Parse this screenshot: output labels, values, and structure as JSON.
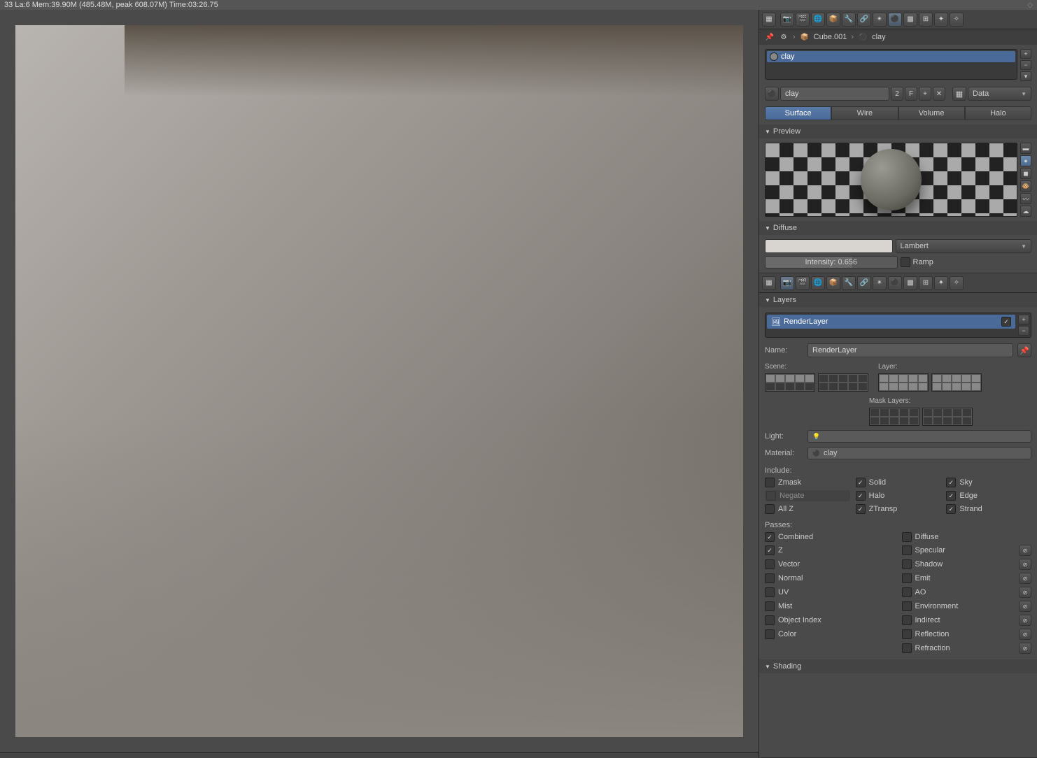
{
  "status_bar": {
    "left": "33 La:6 Mem:39.90M (485.48M, peak 608.07M) Time:03:26.75",
    "right_icon": "◇"
  },
  "properties1": {
    "tabs": [
      "▦",
      "📷",
      "🎬",
      "🌐",
      "📦",
      "🔧",
      "🔗",
      "✴",
      "⚫",
      "▩",
      "⊞",
      "✦",
      "✧"
    ],
    "breadcrumb": {
      "pin": "📌",
      "obj_icon": "📦",
      "obj_name": "Cube.001",
      "mat_icon": "⚫",
      "mat_name": "clay"
    },
    "material_slot": "clay",
    "material_name": "clay",
    "user_count": "2",
    "fake_user": "F",
    "add_new": "+",
    "unlink": "✕",
    "node_icon": "▦",
    "link_mode": "Data",
    "type_tabs": [
      "Surface",
      "Wire",
      "Volume",
      "Halo"
    ],
    "preview_label": "Preview",
    "diffuse": {
      "label": "Diffuse",
      "shader": "Lambert",
      "intensity_label": "Intensity: 0.656",
      "ramp": "Ramp"
    }
  },
  "properties2": {
    "tabs": [
      "▦",
      "📷",
      "🎬",
      "🌐",
      "📦",
      "🔧",
      "🔗",
      "✴",
      "⚫",
      "▩",
      "⊞",
      "✦",
      "✧"
    ],
    "layers_label": "Layers",
    "render_layer": "RenderLayer",
    "name_label": "Name:",
    "name_value": "RenderLayer",
    "scene_label": "Scene:",
    "layer_label": "Layer:",
    "mask_label": "Mask Layers:",
    "light_label": "Light:",
    "light_value": "",
    "material_label": "Material:",
    "material_value": "clay",
    "include_label": "Include:",
    "include": [
      {
        "label": "Zmask",
        "checked": false
      },
      {
        "label": "Solid",
        "checked": true
      },
      {
        "label": "Sky",
        "checked": true
      },
      {
        "label": "Negate",
        "checked": false,
        "disabled": true
      },
      {
        "label": "Halo",
        "checked": true
      },
      {
        "label": "Edge",
        "checked": true
      },
      {
        "label": "All Z",
        "checked": false
      },
      {
        "label": "ZTransp",
        "checked": true
      },
      {
        "label": "Strand",
        "checked": true
      }
    ],
    "passes_label": "Passes:",
    "passes_left": [
      {
        "label": "Combined",
        "checked": true,
        "excl": false
      },
      {
        "label": "Z",
        "checked": true,
        "excl": false
      },
      {
        "label": "Vector",
        "checked": false,
        "excl": false
      },
      {
        "label": "Normal",
        "checked": false,
        "excl": false
      },
      {
        "label": "UV",
        "checked": false,
        "excl": false
      },
      {
        "label": "Mist",
        "checked": false,
        "excl": false
      },
      {
        "label": "Object Index",
        "checked": false,
        "excl": false
      },
      {
        "label": "Color",
        "checked": false,
        "excl": false
      }
    ],
    "passes_right": [
      {
        "label": "Diffuse",
        "checked": false,
        "excl": false
      },
      {
        "label": "Specular",
        "checked": false,
        "excl": true
      },
      {
        "label": "Shadow",
        "checked": false,
        "excl": true
      },
      {
        "label": "Emit",
        "checked": false,
        "excl": true
      },
      {
        "label": "AO",
        "checked": false,
        "excl": true
      },
      {
        "label": "Environment",
        "checked": false,
        "excl": true
      },
      {
        "label": "Indirect",
        "checked": false,
        "excl": true
      },
      {
        "label": "Reflection",
        "checked": false,
        "excl": true
      },
      {
        "label": "Refraction",
        "checked": false,
        "excl": true
      }
    ],
    "shading_label": "Shading"
  }
}
